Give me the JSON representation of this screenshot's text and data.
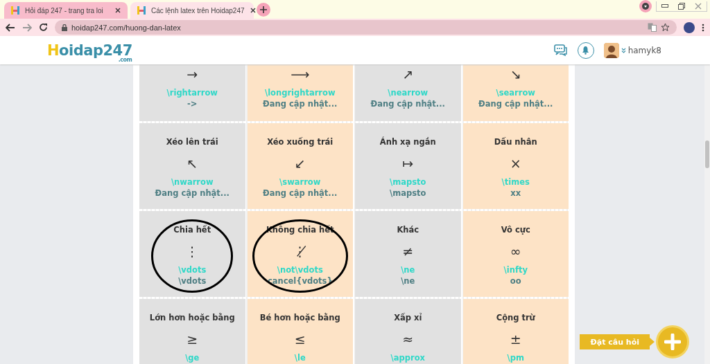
{
  "browser": {
    "tabs": [
      {
        "title": "Hỏi đáp 247 - trang tra loi",
        "selected": false
      },
      {
        "title": "Các lệnh latex trên Hoidap247",
        "selected": true
      }
    ],
    "address": "hoidap247.com/huong-dan-latex"
  },
  "header": {
    "logo_initial": "H",
    "logo": "oidap247",
    "logo_suffix": ".com",
    "username": "hamyk8"
  },
  "rows": [
    {
      "cells": [
        {
          "symbol": "→",
          "command": "\\rightarrow",
          "ascii": "->",
          "circled": false
        },
        {
          "symbol": "⟶",
          "command": "\\longrightarrow",
          "ascii": "Đang cập nhật...",
          "circled": false
        },
        {
          "symbol": "↗",
          "command": "\\nearrow",
          "ascii": "Đang cập nhật...",
          "circled": false
        },
        {
          "symbol": "↘",
          "command": "\\searrow",
          "ascii": "Đang cập nhật...",
          "circled": false
        }
      ]
    },
    {
      "cells": [
        {
          "title": "Xéo lên trái",
          "symbol": "↖",
          "command": "\\nwarrow",
          "ascii": "Đang cập nhật...",
          "circled": false
        },
        {
          "title": "Xéo xuống trái",
          "symbol": "↙",
          "command": "\\swarrow",
          "ascii": "Đang cập nhật...",
          "circled": false
        },
        {
          "title": "Ánh xạ ngắn",
          "symbol": "↦",
          "command": "\\mapsto",
          "ascii": "\\mapsto",
          "circled": false
        },
        {
          "title": "Dấu nhân",
          "symbol": "×",
          "command": "\\times",
          "ascii": "xx",
          "circled": false
        }
      ]
    },
    {
      "cells": [
        {
          "title": "Chia hết",
          "symbol": "⋮",
          "command": "\\vdots",
          "ascii": "\\vdots",
          "circled": true
        },
        {
          "title": "Không chia hết",
          "symbol": "⋮̸",
          "command": "\\not\\vdots",
          "ascii": "cancel{vdots}",
          "circled": true
        },
        {
          "title": "Khác",
          "symbol": "≠",
          "command": "\\ne",
          "ascii": "\\ne",
          "circled": false
        },
        {
          "title": "Vô cực",
          "symbol": "∞",
          "command": "\\infty",
          "ascii": "oo",
          "circled": false
        }
      ]
    },
    {
      "cells": [
        {
          "title": "Lớn hơn hoặc bằng",
          "symbol": "≥",
          "command": "\\ge",
          "circled": false
        },
        {
          "title": "Bé hơn hoặc bằng",
          "symbol": "≤",
          "command": "\\le",
          "circled": false
        },
        {
          "title": "Xấp xỉ",
          "symbol": "≈",
          "command": "\\approx",
          "circled": false
        },
        {
          "title": "Cộng trừ",
          "symbol": "±",
          "command": "\\pm",
          "circled": false
        }
      ]
    }
  ],
  "ask_button": "Đặt câu hỏi"
}
